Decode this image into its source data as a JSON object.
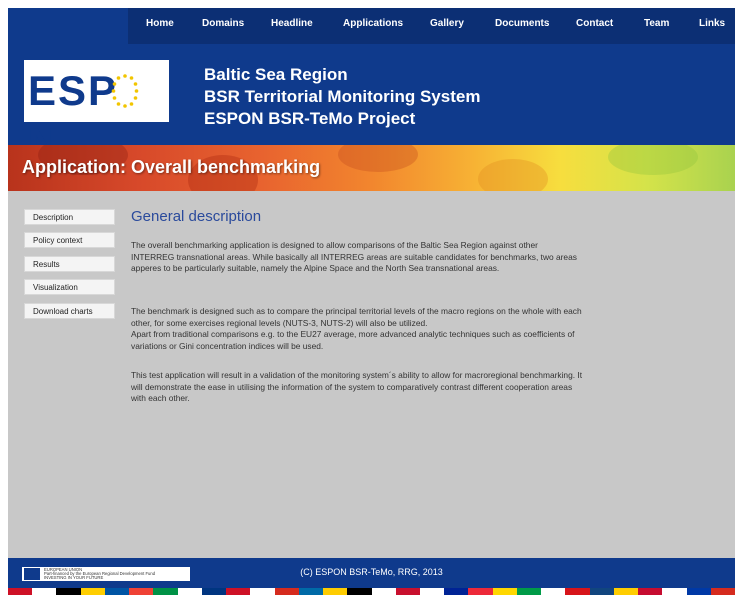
{
  "nav": [
    "Home",
    "Domains",
    "Headline",
    "Applications",
    "Gallery",
    "Documents",
    "Contact",
    "Team",
    "Links"
  ],
  "logo": {
    "text": "ESPON"
  },
  "site": {
    "line1": "Baltic Sea Region",
    "line2": "BSR Territorial Monitoring System",
    "line3": "ESPON BSR-TeMo Project"
  },
  "banner": {
    "title": "Application: Overall benchmarking"
  },
  "sidebar": [
    "Description",
    "Policy context",
    "Results",
    "Visualization",
    "Download charts"
  ],
  "content": {
    "title": "General description",
    "p1": "The overall benchmarking application is designed to allow comparisons of the Baltic Sea Region against other INTERREG transnational areas. While basically all INTERREG areas are suitable candidates for benchmarks, two areas apperes to be particularly suitable, namely the Alpine Space and the North Sea transnational areas.",
    "p2": "The benchmark is designed such as to compare the principal territorial levels of the macro regions on the whole with each other, for some exercises regional levels (NUTS-3, NUTS-2) will also be utilized.",
    "p3": "Apart from traditional comparisons e.g. to the EU27 average, more advanced analytic techniques such as coefficients of variations or Gini concentration indices will be used.",
    "p4": "This test application will result in a validation of the monitoring system´s ability to allow for macroregional benchmarking. It will demonstrate the ease in utilising the information of the system to comparatively contrast different cooperation areas with each other."
  },
  "footer": {
    "eu_line1": "EUROPEAN UNION",
    "eu_line2": "Part-financed by the European Regional Development Fund",
    "eu_line3": "INVESTING IN YOUR FUTURE",
    "copyright": "(C) ESPON BSR-TeMo, RRG, 2013"
  },
  "colors": {
    "header": "#0f3a8c",
    "nav": "#0c2f74",
    "title_blue": "#2a4a9c",
    "background": "#c8c8c8"
  }
}
